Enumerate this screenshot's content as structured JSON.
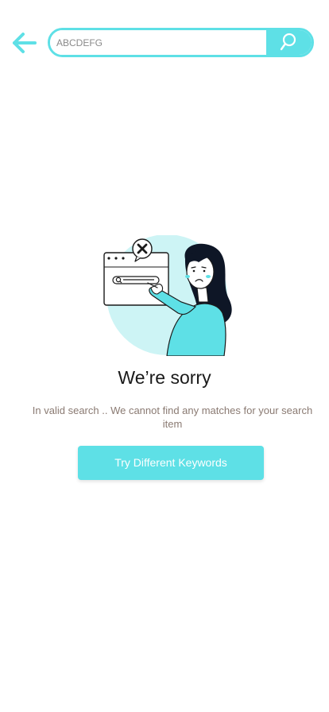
{
  "colors": {
    "accent": "#5ee0e6",
    "title": "#1a1a1a",
    "message": "#8a7a72"
  },
  "header": {
    "back_icon": "arrow-left-icon"
  },
  "search": {
    "value": "ABCDEFG",
    "button_icon": "search-icon"
  },
  "empty_state": {
    "illustration": "sad-girl-search-illustration",
    "title": "We’re sorry",
    "message": "In valid search .. We cannot find any matches for your search item",
    "button_label": "Try Different Keywords"
  }
}
